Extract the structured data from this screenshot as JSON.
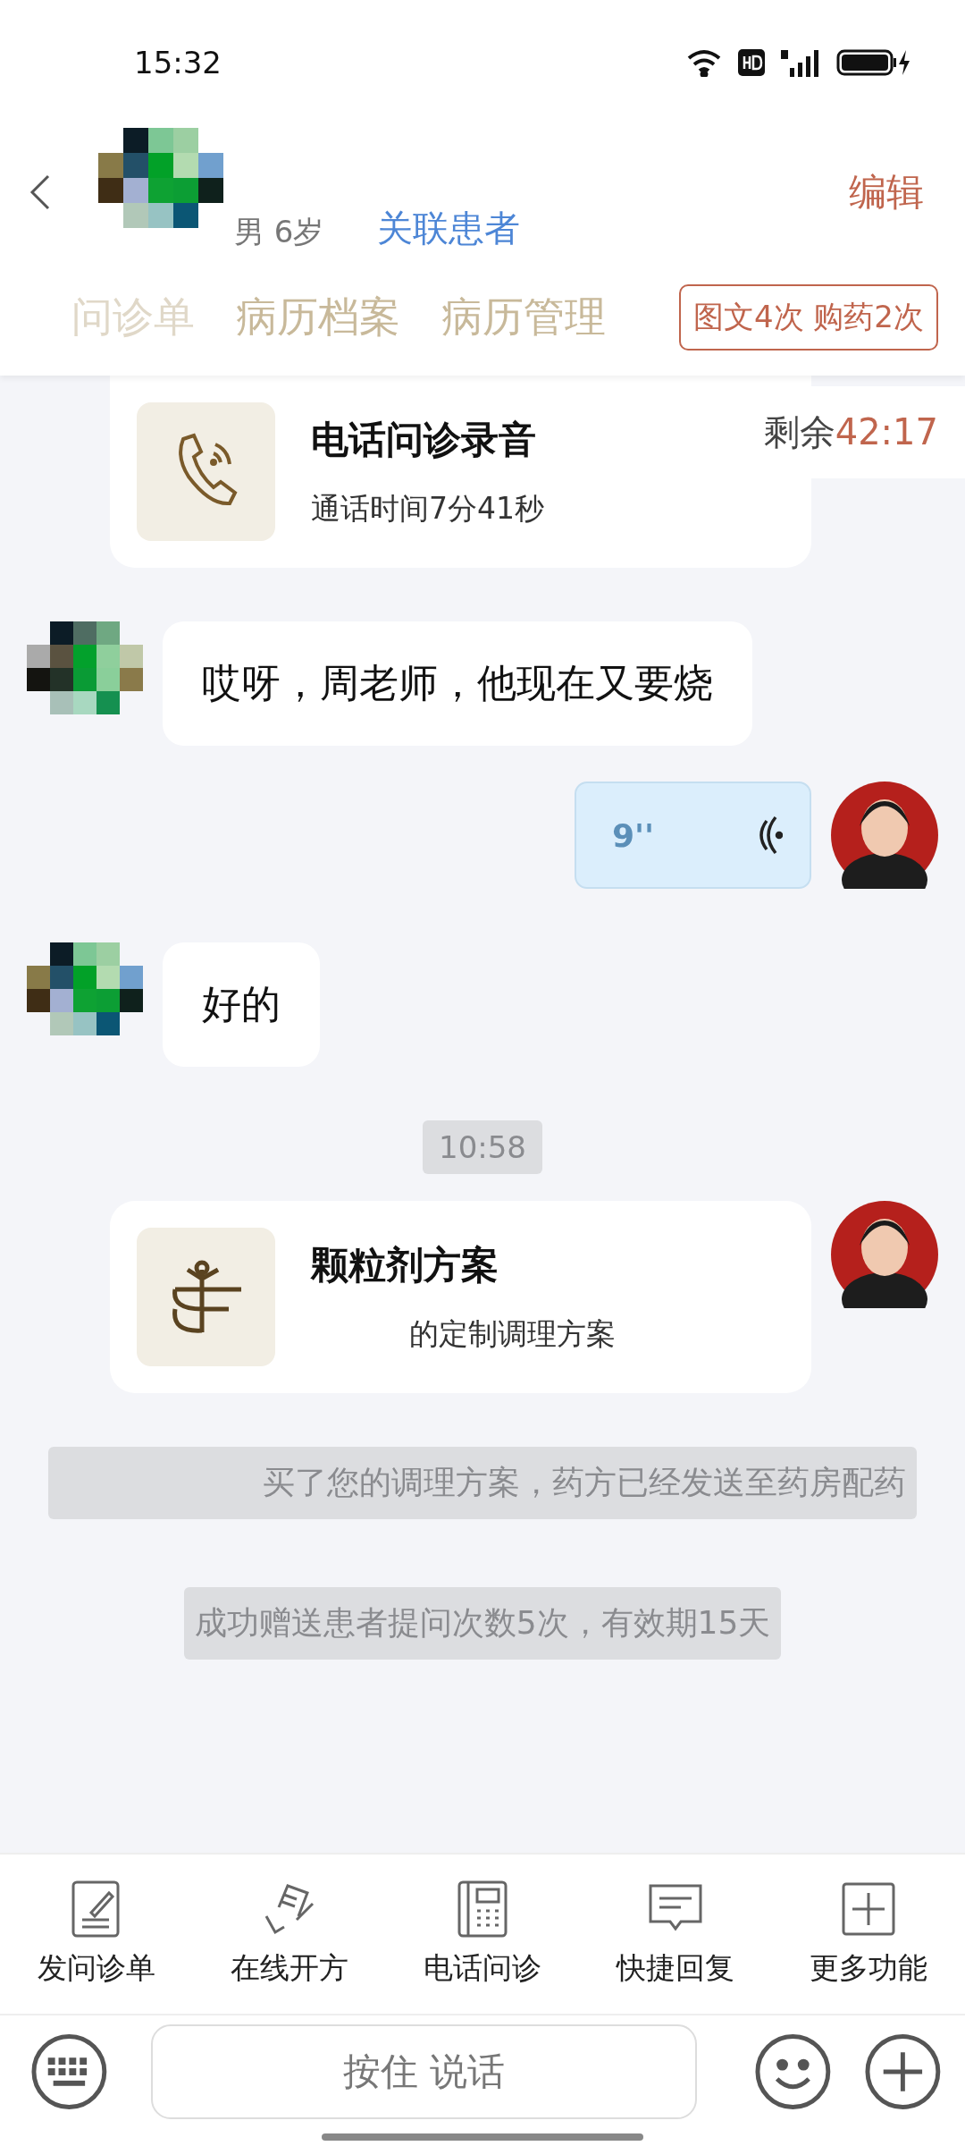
{
  "status_bar": {
    "time": "15:32"
  },
  "header": {
    "gender_age": "男 6岁",
    "link": "关联患者",
    "edit": "编辑"
  },
  "tabs": [
    {
      "label": "问诊单",
      "faded": true
    },
    {
      "label": "病历档案",
      "faded": false
    },
    {
      "label": "病历管理",
      "faded": false
    }
  ],
  "quota_badge": "图文4次 购药2次",
  "remaining": {
    "label": "剩余",
    "time": "42:17"
  },
  "messages": [
    {
      "kind": "call",
      "title": "电话问诊录音",
      "subtitle": "通话时间7分41秒"
    },
    {
      "kind": "text",
      "text": "哎呀，周老师，他现在又要烧"
    },
    {
      "kind": "voice",
      "duration": "9''"
    },
    {
      "kind": "text",
      "text": "好的"
    },
    {
      "kind": "time",
      "text": "10:58"
    },
    {
      "kind": "plan",
      "title": "颗粒剂方案",
      "subtitle": "的定制调理方案"
    },
    {
      "kind": "system",
      "text": "买了您的调理方案，药方已经发送至药房配药"
    },
    {
      "kind": "system",
      "text": "成功赠送患者提问次数5次，有效期15天"
    }
  ],
  "tools": [
    {
      "label": "发问诊单"
    },
    {
      "label": "在线开方"
    },
    {
      "label": "电话问诊"
    },
    {
      "label": "快捷回复"
    },
    {
      "label": "更多功能"
    }
  ],
  "input": {
    "hold_to_talk": "按住 说话"
  }
}
